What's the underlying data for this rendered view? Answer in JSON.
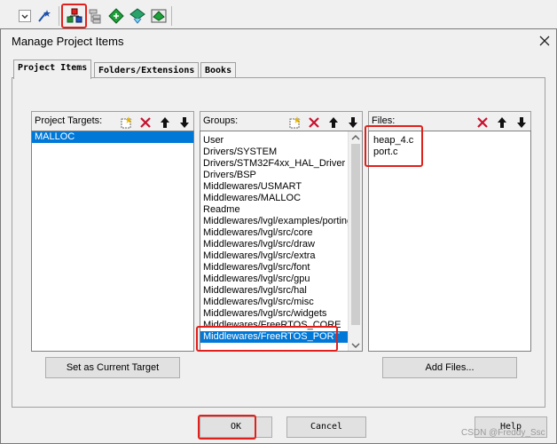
{
  "dialog": {
    "title": "Manage Project Items",
    "tabs": [
      "Project Items",
      "Folders/Extensions",
      "Books"
    ]
  },
  "targets": {
    "header": "Project Targets:",
    "items": [
      "MALLOC"
    ]
  },
  "groups": {
    "header": "Groups:",
    "items": [
      "User",
      "Drivers/SYSTEM",
      "Drivers/STM32F4xx_HAL_Driver",
      "Drivers/BSP",
      "Middlewares/USMART",
      "Middlewares/MALLOC",
      "Readme",
      "Middlewares/lvgl/examples/porting",
      "Middlewares/lvgl/src/core",
      "Middlewares/lvgl/src/draw",
      "Middlewares/lvgl/src/extra",
      "Middlewares/lvgl/src/font",
      "Middlewares/lvgl/src/gpu",
      "Middlewares/lvgl/src/hal",
      "Middlewares/lvgl/src/misc",
      "Middlewares/lvgl/src/widgets",
      "Middlewares/FreeRTOS_CORE",
      "Middlewares/FreeRTOS_PORT"
    ]
  },
  "files": {
    "header": "Files:",
    "items": [
      "heap_4.c",
      "port.c"
    ]
  },
  "buttons": {
    "set_current": "Set as Current Target",
    "add_files": "Add Files...",
    "ok": "OK",
    "cancel": "Cancel",
    "help": "Help"
  },
  "watermark": "CSDN @Freddy_Ssc",
  "colors": {
    "selection": "#0078d7",
    "highlight_box": "#e0201c"
  },
  "icons": [
    "new-item-icon",
    "delete-icon",
    "move-up-icon",
    "move-down-icon",
    "close-icon"
  ]
}
